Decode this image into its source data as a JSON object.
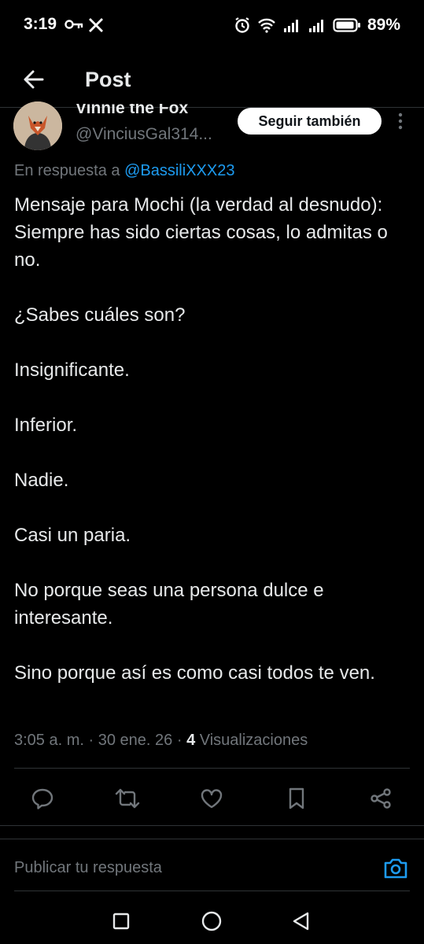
{
  "status_bar": {
    "time": "3:19",
    "battery": "89%"
  },
  "header": {
    "title": "Post"
  },
  "author": {
    "name": "Vinnie the Fox",
    "handle": "@VinciusGal314...",
    "follow_label": "Seguir también"
  },
  "reply": {
    "prefix": "En respuesta a",
    "mention": "@BassiliXXX23"
  },
  "tweet": {
    "paragraphs": [
      "Mensaje para Mochi (la verdad al desnudo): Siempre has sido ciertas cosas, lo admitas o no.",
      "¿Sabes cuáles son?",
      "Insignificante.",
      "Inferior.",
      "Nadie.",
      "Casi un paria.",
      "No porque seas una persona dulce e interesante.",
      "Sino porque así es como casi todos te ven."
    ]
  },
  "meta": {
    "time": "3:05 a. m.",
    "sep1": "·",
    "date": "30 ene. 26",
    "sep2": "·",
    "views_count": "4",
    "views_label": "Visualizaciones"
  },
  "actions": [
    "reply-icon",
    "retweet-icon",
    "like-icon",
    "bookmark-icon",
    "share-icon"
  ],
  "composer": {
    "placeholder": "Publicar tu respuesta"
  },
  "colors": {
    "background": "#000000",
    "accent": "#1d9bf0",
    "text": "#e7e9ea",
    "muted": "#71767b"
  }
}
